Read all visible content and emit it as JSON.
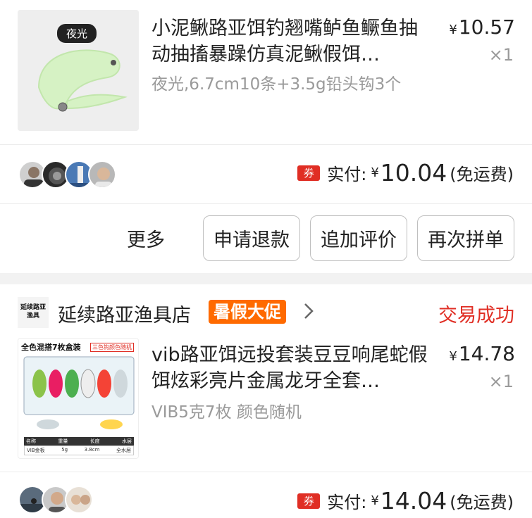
{
  "orders": [
    {
      "thumb_badge": "夜光",
      "title": "小泥鳅路亚饵钓翘嘴鲈鱼鳜鱼抽动抽搐暴躁仿真泥鳅假饵…",
      "spec": "夜光,6.7cm10条+3.5g铅头钩3个",
      "price": "10.57",
      "qty": "×1",
      "coupon": "券",
      "pay_label": "实付:",
      "pay_amount": "10.04",
      "pay_note": "(免运费)",
      "more": "更多",
      "buttons": [
        "申请退款",
        "追加评价",
        "再次拼单"
      ]
    },
    {
      "store_logo_text": "延续路亚渔具",
      "store_name": "延续路亚渔具店",
      "promo": "暑假大促",
      "status": "交易成功",
      "thumb_header": "全色混搭7枚盒装",
      "thumb_tag": "三色钩颜色随机",
      "thumb_table": {
        "headers": [
          "名称",
          "重量",
          "长度",
          "水层"
        ],
        "row": [
          "VIB金板",
          "5g",
          "3.8cm",
          "全水层"
        ]
      },
      "title": "vib路亚饵远投套装豆豆响尾蛇假饵炫彩亮片金属龙牙全套…",
      "spec": "VIB5克7枚  颜色随机",
      "price": "14.78",
      "qty": "×1",
      "coupon": "券",
      "pay_label": "实付:",
      "pay_amount": "14.04",
      "pay_note": "(免运费)"
    }
  ],
  "currency": "¥",
  "colors": {
    "accent_red": "#e02e24",
    "promo_orange": "#ff6a00",
    "glow_green": "#d6f2c4"
  }
}
